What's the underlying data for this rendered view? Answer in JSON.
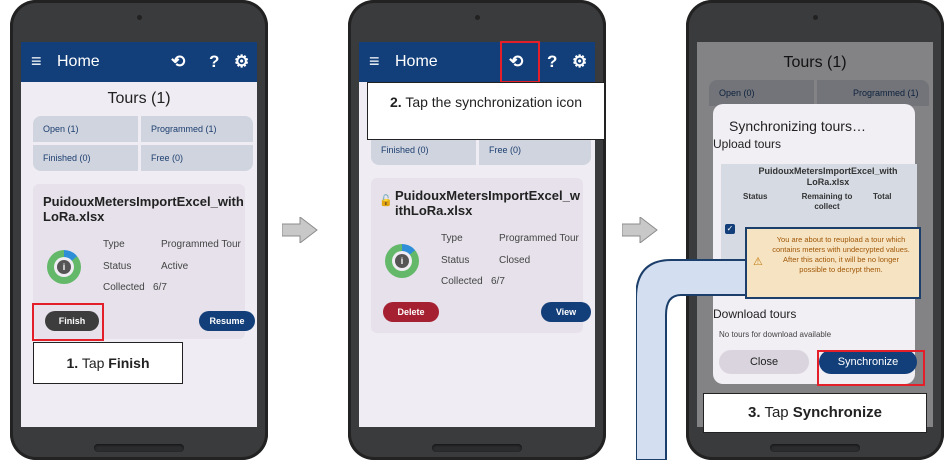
{
  "colors": {
    "appbar": "#123f7a",
    "accent_red": "#e3202a",
    "delete_btn": "#a52030",
    "primary_btn": "#123f7a"
  },
  "common": {
    "home_title": "Home",
    "tours_title": "Tours (1)",
    "help_glyph": "?"
  },
  "chips": {
    "open": "Open (1)",
    "programmed": "Programmed (1)",
    "finished": "Finished (0)",
    "free": "Free (0)"
  },
  "panel1": {
    "file_name": "PuidouxMetersImportExcel_with LoRa.xlsx",
    "type_label": "Type",
    "type_value": "Programmed Tour",
    "status_label": "Status",
    "status_value": "Active",
    "collected_label": "Collected",
    "collected_value": "6/7",
    "finish_btn": "Finish",
    "resume_btn": "Resume",
    "callout_num": "1.",
    "callout_text": "Tap ",
    "callout_bold": "Finish"
  },
  "panel2": {
    "file_name": "PuidouxMetersImportExcel_w ithLoRa.xlsx",
    "type_label": "Type",
    "type_value": "Programmed Tour",
    "status_label": "Status",
    "status_value": "Closed",
    "collected_label": "Collected",
    "collected_value": "6/7",
    "delete_btn": "Delete",
    "view_btn": "View",
    "callout_num": "2.",
    "callout_text": "Tap the synchronization icon"
  },
  "panel3": {
    "bg_tours_title": "Tours (1)",
    "bg_open": "Open (0)",
    "bg_programmed": "Programmed (1)",
    "dialog_title": "Synchronizing tours…",
    "upload_heading": "Upload tours",
    "table_file": "PuidouxMetersImportExcel_with LoRa.xlsx",
    "col_status": "Status",
    "col_remaining": "Remaining to collect",
    "col_total": "Total",
    "warning": "You are about to reupload a tour which contains meters with undecrypted values. After this action, it will be no longer possible to decrypt them.",
    "download_heading": "Download tours",
    "download_note": "No tours for download available",
    "close_btn": "Close",
    "sync_btn": "Synchronize",
    "callout_num": "3.",
    "callout_text": "Tap ",
    "callout_bold": "Synchronize"
  }
}
